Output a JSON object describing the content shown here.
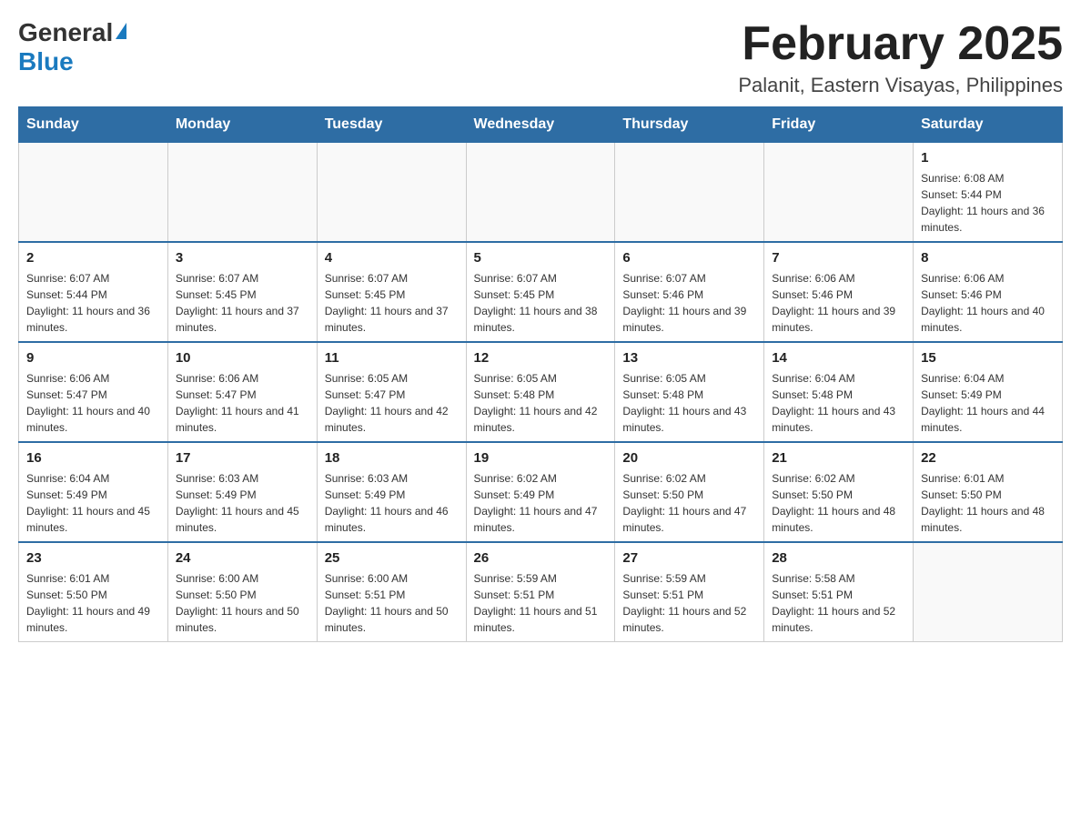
{
  "header": {
    "logo_general": "General",
    "logo_blue": "Blue",
    "month_title": "February 2025",
    "location": "Palanit, Eastern Visayas, Philippines"
  },
  "days_of_week": [
    "Sunday",
    "Monday",
    "Tuesday",
    "Wednesday",
    "Thursday",
    "Friday",
    "Saturday"
  ],
  "weeks": [
    {
      "days": [
        {
          "date": "",
          "info": ""
        },
        {
          "date": "",
          "info": ""
        },
        {
          "date": "",
          "info": ""
        },
        {
          "date": "",
          "info": ""
        },
        {
          "date": "",
          "info": ""
        },
        {
          "date": "",
          "info": ""
        },
        {
          "date": "1",
          "info": "Sunrise: 6:08 AM\nSunset: 5:44 PM\nDaylight: 11 hours and 36 minutes."
        }
      ]
    },
    {
      "days": [
        {
          "date": "2",
          "info": "Sunrise: 6:07 AM\nSunset: 5:44 PM\nDaylight: 11 hours and 36 minutes."
        },
        {
          "date": "3",
          "info": "Sunrise: 6:07 AM\nSunset: 5:45 PM\nDaylight: 11 hours and 37 minutes."
        },
        {
          "date": "4",
          "info": "Sunrise: 6:07 AM\nSunset: 5:45 PM\nDaylight: 11 hours and 37 minutes."
        },
        {
          "date": "5",
          "info": "Sunrise: 6:07 AM\nSunset: 5:45 PM\nDaylight: 11 hours and 38 minutes."
        },
        {
          "date": "6",
          "info": "Sunrise: 6:07 AM\nSunset: 5:46 PM\nDaylight: 11 hours and 39 minutes."
        },
        {
          "date": "7",
          "info": "Sunrise: 6:06 AM\nSunset: 5:46 PM\nDaylight: 11 hours and 39 minutes."
        },
        {
          "date": "8",
          "info": "Sunrise: 6:06 AM\nSunset: 5:46 PM\nDaylight: 11 hours and 40 minutes."
        }
      ]
    },
    {
      "days": [
        {
          "date": "9",
          "info": "Sunrise: 6:06 AM\nSunset: 5:47 PM\nDaylight: 11 hours and 40 minutes."
        },
        {
          "date": "10",
          "info": "Sunrise: 6:06 AM\nSunset: 5:47 PM\nDaylight: 11 hours and 41 minutes."
        },
        {
          "date": "11",
          "info": "Sunrise: 6:05 AM\nSunset: 5:47 PM\nDaylight: 11 hours and 42 minutes."
        },
        {
          "date": "12",
          "info": "Sunrise: 6:05 AM\nSunset: 5:48 PM\nDaylight: 11 hours and 42 minutes."
        },
        {
          "date": "13",
          "info": "Sunrise: 6:05 AM\nSunset: 5:48 PM\nDaylight: 11 hours and 43 minutes."
        },
        {
          "date": "14",
          "info": "Sunrise: 6:04 AM\nSunset: 5:48 PM\nDaylight: 11 hours and 43 minutes."
        },
        {
          "date": "15",
          "info": "Sunrise: 6:04 AM\nSunset: 5:49 PM\nDaylight: 11 hours and 44 minutes."
        }
      ]
    },
    {
      "days": [
        {
          "date": "16",
          "info": "Sunrise: 6:04 AM\nSunset: 5:49 PM\nDaylight: 11 hours and 45 minutes."
        },
        {
          "date": "17",
          "info": "Sunrise: 6:03 AM\nSunset: 5:49 PM\nDaylight: 11 hours and 45 minutes."
        },
        {
          "date": "18",
          "info": "Sunrise: 6:03 AM\nSunset: 5:49 PM\nDaylight: 11 hours and 46 minutes."
        },
        {
          "date": "19",
          "info": "Sunrise: 6:02 AM\nSunset: 5:49 PM\nDaylight: 11 hours and 47 minutes."
        },
        {
          "date": "20",
          "info": "Sunrise: 6:02 AM\nSunset: 5:50 PM\nDaylight: 11 hours and 47 minutes."
        },
        {
          "date": "21",
          "info": "Sunrise: 6:02 AM\nSunset: 5:50 PM\nDaylight: 11 hours and 48 minutes."
        },
        {
          "date": "22",
          "info": "Sunrise: 6:01 AM\nSunset: 5:50 PM\nDaylight: 11 hours and 48 minutes."
        }
      ]
    },
    {
      "days": [
        {
          "date": "23",
          "info": "Sunrise: 6:01 AM\nSunset: 5:50 PM\nDaylight: 11 hours and 49 minutes."
        },
        {
          "date": "24",
          "info": "Sunrise: 6:00 AM\nSunset: 5:50 PM\nDaylight: 11 hours and 50 minutes."
        },
        {
          "date": "25",
          "info": "Sunrise: 6:00 AM\nSunset: 5:51 PM\nDaylight: 11 hours and 50 minutes."
        },
        {
          "date": "26",
          "info": "Sunrise: 5:59 AM\nSunset: 5:51 PM\nDaylight: 11 hours and 51 minutes."
        },
        {
          "date": "27",
          "info": "Sunrise: 5:59 AM\nSunset: 5:51 PM\nDaylight: 11 hours and 52 minutes."
        },
        {
          "date": "28",
          "info": "Sunrise: 5:58 AM\nSunset: 5:51 PM\nDaylight: 11 hours and 52 minutes."
        },
        {
          "date": "",
          "info": ""
        }
      ]
    }
  ]
}
